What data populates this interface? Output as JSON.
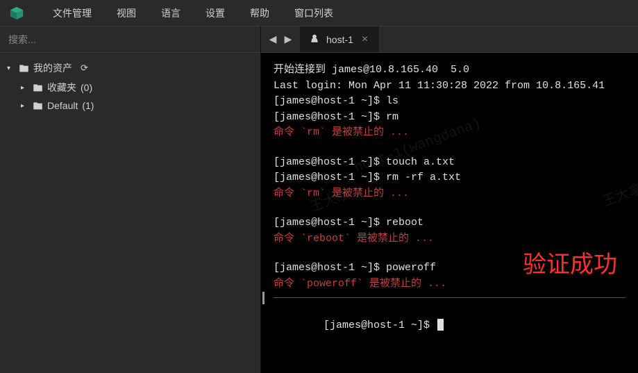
{
  "menubar": {
    "items": [
      "文件管理",
      "视图",
      "语言",
      "设置",
      "帮助",
      "窗口列表"
    ]
  },
  "search": {
    "label": "搜索",
    "suffix": "..."
  },
  "tree": {
    "root": {
      "label": "我的资产"
    },
    "children": [
      {
        "label": "收藏夹",
        "count": "(0)"
      },
      {
        "label": "Default",
        "count": "(1)"
      }
    ]
  },
  "tabs": {
    "active": {
      "label": "host-1"
    }
  },
  "terminal": {
    "lines": [
      {
        "t": "开始连接到 james@10.8.165.40  5.0",
        "c": "w"
      },
      {
        "t": "Last login: Mon Apr 11 11:30:28 2022 from 10.8.165.41",
        "c": "w"
      },
      {
        "t": "[james@host-1 ~]$ ls",
        "c": "w"
      },
      {
        "t": "[james@host-1 ~]$ rm",
        "c": "w"
      },
      {
        "t": "命令 `rm` 是被禁止的 ...",
        "c": "r"
      },
      {
        "t": "",
        "c": "gap"
      },
      {
        "t": "[james@host-1 ~]$ touch a.txt",
        "c": "w"
      },
      {
        "t": "[james@host-1 ~]$ rm -rf a.txt",
        "c": "w"
      },
      {
        "t": "命令 `rm` 是被禁止的 ...",
        "c": "r"
      },
      {
        "t": "",
        "c": "gap"
      },
      {
        "t": "[james@host-1 ~]$ reboot",
        "c": "w"
      },
      {
        "t": "命令 `reboot` 是被禁止的 ...",
        "c": "r"
      },
      {
        "t": "",
        "c": "gap"
      },
      {
        "t": "[james@host-1 ~]$ poweroff",
        "c": "w"
      },
      {
        "t": "命令 `poweroff` 是被禁止的 ...",
        "c": "r"
      }
    ],
    "prompt": "[james@host-1 ~]$ "
  },
  "badge": "验证成功",
  "watermarks": [
    "host-1(wangdana)",
    "王大拿(",
    "王大拿"
  ]
}
